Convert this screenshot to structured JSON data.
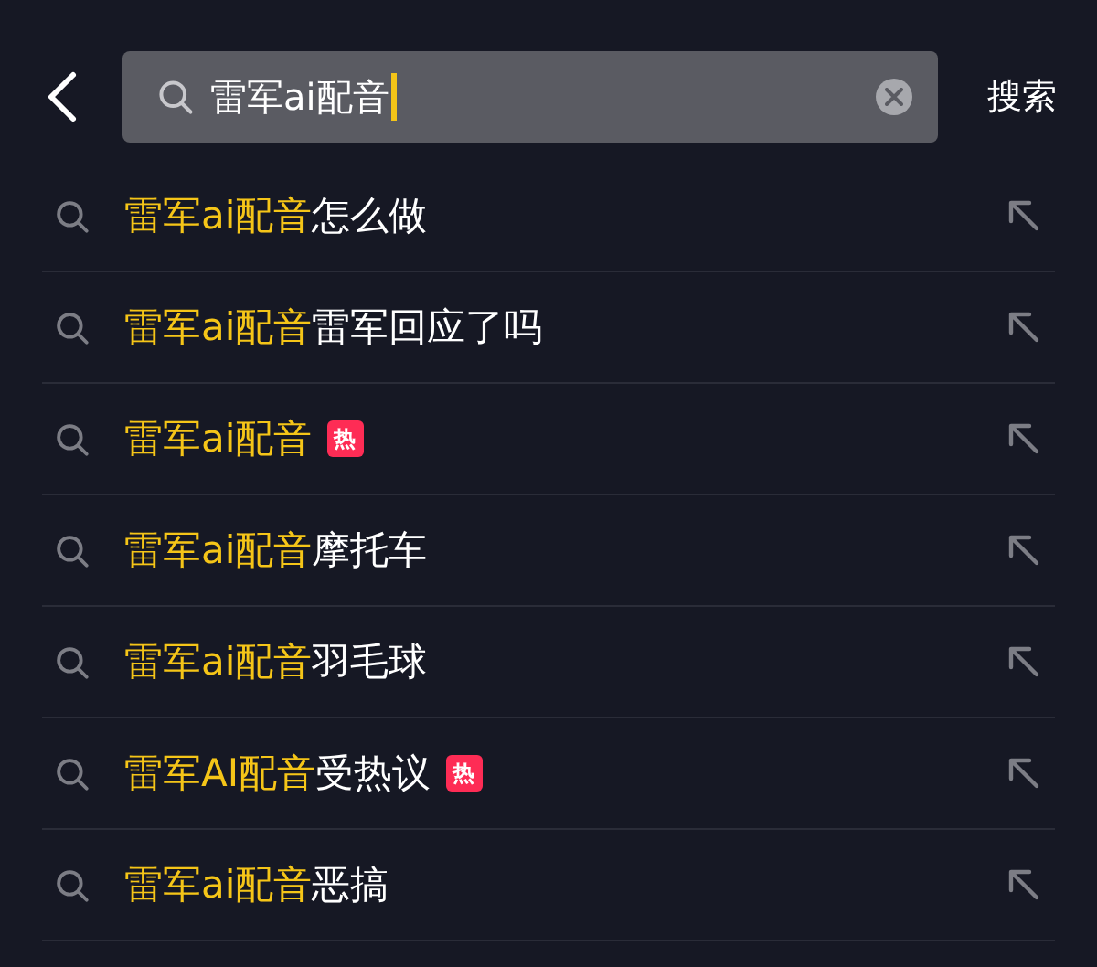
{
  "search": {
    "value": "雷军ai配音",
    "submit": "搜索"
  },
  "suggestions": [
    {
      "match": "雷军ai配音",
      "rest": "怎么做"
    },
    {
      "match": "雷军ai配音",
      "rest": "雷军回应了吗"
    },
    {
      "match": "雷军ai配音",
      "badge": "热"
    },
    {
      "match": "雷军ai配音",
      "rest": "摩托车"
    },
    {
      "match": "雷军ai配音",
      "rest": "羽毛球"
    },
    {
      "match": "雷军AI配音",
      "rest": "受热议",
      "badge": "热"
    },
    {
      "match": "雷军ai配音",
      "rest": "恶搞"
    }
  ]
}
